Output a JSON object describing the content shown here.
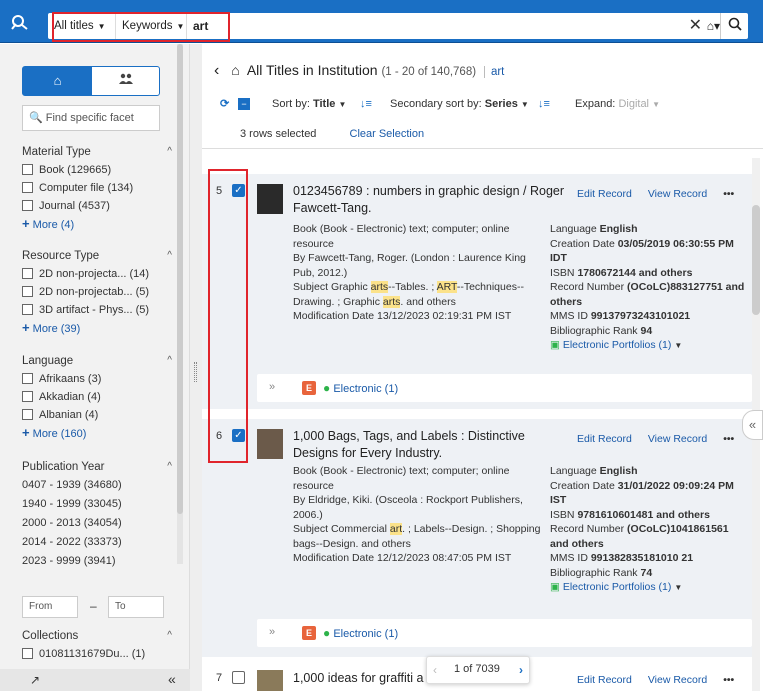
{
  "search": {
    "scope": "All titles",
    "field": "Keywords",
    "query": "art",
    "clear_icon": "✕",
    "home_icon": "⌂▾",
    "search_icon": "⚲"
  },
  "sidebar": {
    "tab_home_icon": "⌂",
    "tab_people_icon": "👥",
    "find_facet_placeholder": "🔍 Find specific facet",
    "groups": [
      {
        "title": "Material Type",
        "items": [
          "Book (129665)",
          "Computer file (134)",
          "Journal (4537)"
        ],
        "more": "More (4)"
      },
      {
        "title": "Resource Type",
        "items": [
          "2D non-projecta... (14)",
          "2D non-projectab... (5)",
          "3D artifact - Phys... (5)"
        ],
        "more": "More (39)"
      },
      {
        "title": "Language",
        "items": [
          "Afrikaans (3)",
          "Akkadian (4)",
          "Albanian (4)"
        ],
        "more": "More (160)"
      },
      {
        "title": "Publication Year",
        "items": [
          "0407 - 1939 (34680)",
          "1940 - 1999 (33045)",
          "2000 - 2013 (34054)",
          "2014 - 2022 (33373)",
          "2023 - 9999 (3941)"
        ]
      },
      {
        "title": "Collections",
        "items": [
          "01081131679Du... (1)"
        ]
      }
    ],
    "range_from": "From",
    "range_to": "To",
    "bottom_left_icon": "↗",
    "collapse_icon": "«"
  },
  "main": {
    "back_icon": "‹",
    "home_icon": "⌂",
    "title": "All Titles in Institution",
    "count": "(1 - 20 of 140,768)",
    "query_tag": "art",
    "toolbar": {
      "refresh_icon": "⟳",
      "sort_label": "Sort by:",
      "sort_value": "Title",
      "secondary_label": "Secondary sort by:",
      "secondary_value": "Series",
      "expand_label": "Expand:",
      "expand_value": "Digital"
    },
    "selection": {
      "text": "3 rows selected",
      "clear": "Clear Selection"
    },
    "records": [
      {
        "num": "5",
        "title": "0123456789 : numbers in graphic design / Roger Fawcett-Tang.",
        "edit": "Edit Record",
        "view": "View Record",
        "more": "•••",
        "type": "Book (Book - Electronic) text; computer; online resource",
        "by": "By Fawcett-Tang, Roger. (London : Laurence King Pub, 2012.)",
        "subject_label": "Subject",
        "subject": "Graphic arts--Tables. ; ART--Techniques--Drawing. ; Graphic arts. and others",
        "mod_label": "Modification Date",
        "mod": "13/12/2023 02:19:31 PM IST",
        "language_label": "Language",
        "language": "English",
        "creation_label": "Creation Date",
        "creation": "03/05/2019 06:30:55 PM IDT",
        "isbn_label": "ISBN",
        "isbn": "1780672144 and others",
        "recnum_label": "Record Number",
        "recnum": "(OCoLC)883127751 and others",
        "mms_label": "MMS ID",
        "mms": "99137973243101021",
        "rank_label": "Bibliographic Rank",
        "rank": "94",
        "portfolios": "Electronic Portfolios (1)",
        "electronic": "Electronic (1)"
      },
      {
        "num": "6",
        "title": "1,000 Bags, Tags, and Labels : Distinctive Designs for Every Industry.",
        "edit": "Edit Record",
        "view": "View Record",
        "more": "•••",
        "type": "Book (Book - Electronic) text; computer; online resource",
        "by": "By Eldridge, Kiki. (Osceola : Rockport Publishers, 2006.)",
        "subject_label": "Subject",
        "subject": "Commercial art. ; Labels--Design. ; Shopping bags--Design. and others",
        "mod_label": "Modification Date",
        "mod": "12/12/2023 08:47:05 PM IST",
        "language_label": "Language",
        "language": "English",
        "creation_label": "Creation Date",
        "creation": "31/01/2022 09:09:24 PM IST",
        "isbn_label": "ISBN",
        "isbn": "9781610601481 and others",
        "recnum_label": "Record Number",
        "recnum": "(OCoLC)1041861561 and others",
        "mms_label": "MMS ID",
        "mms": "991382835181010 21",
        "rank_label": "Bibliographic Rank",
        "rank": "74",
        "portfolios": "Electronic Portfolios (1)",
        "electronic": "Electronic (1)"
      },
      {
        "num": "7",
        "title": "1,000 ideas for graffiti a",
        "edit": "Edit Record",
        "view": "View Record",
        "more": "•••"
      }
    ],
    "pager": "1 of 7039"
  }
}
